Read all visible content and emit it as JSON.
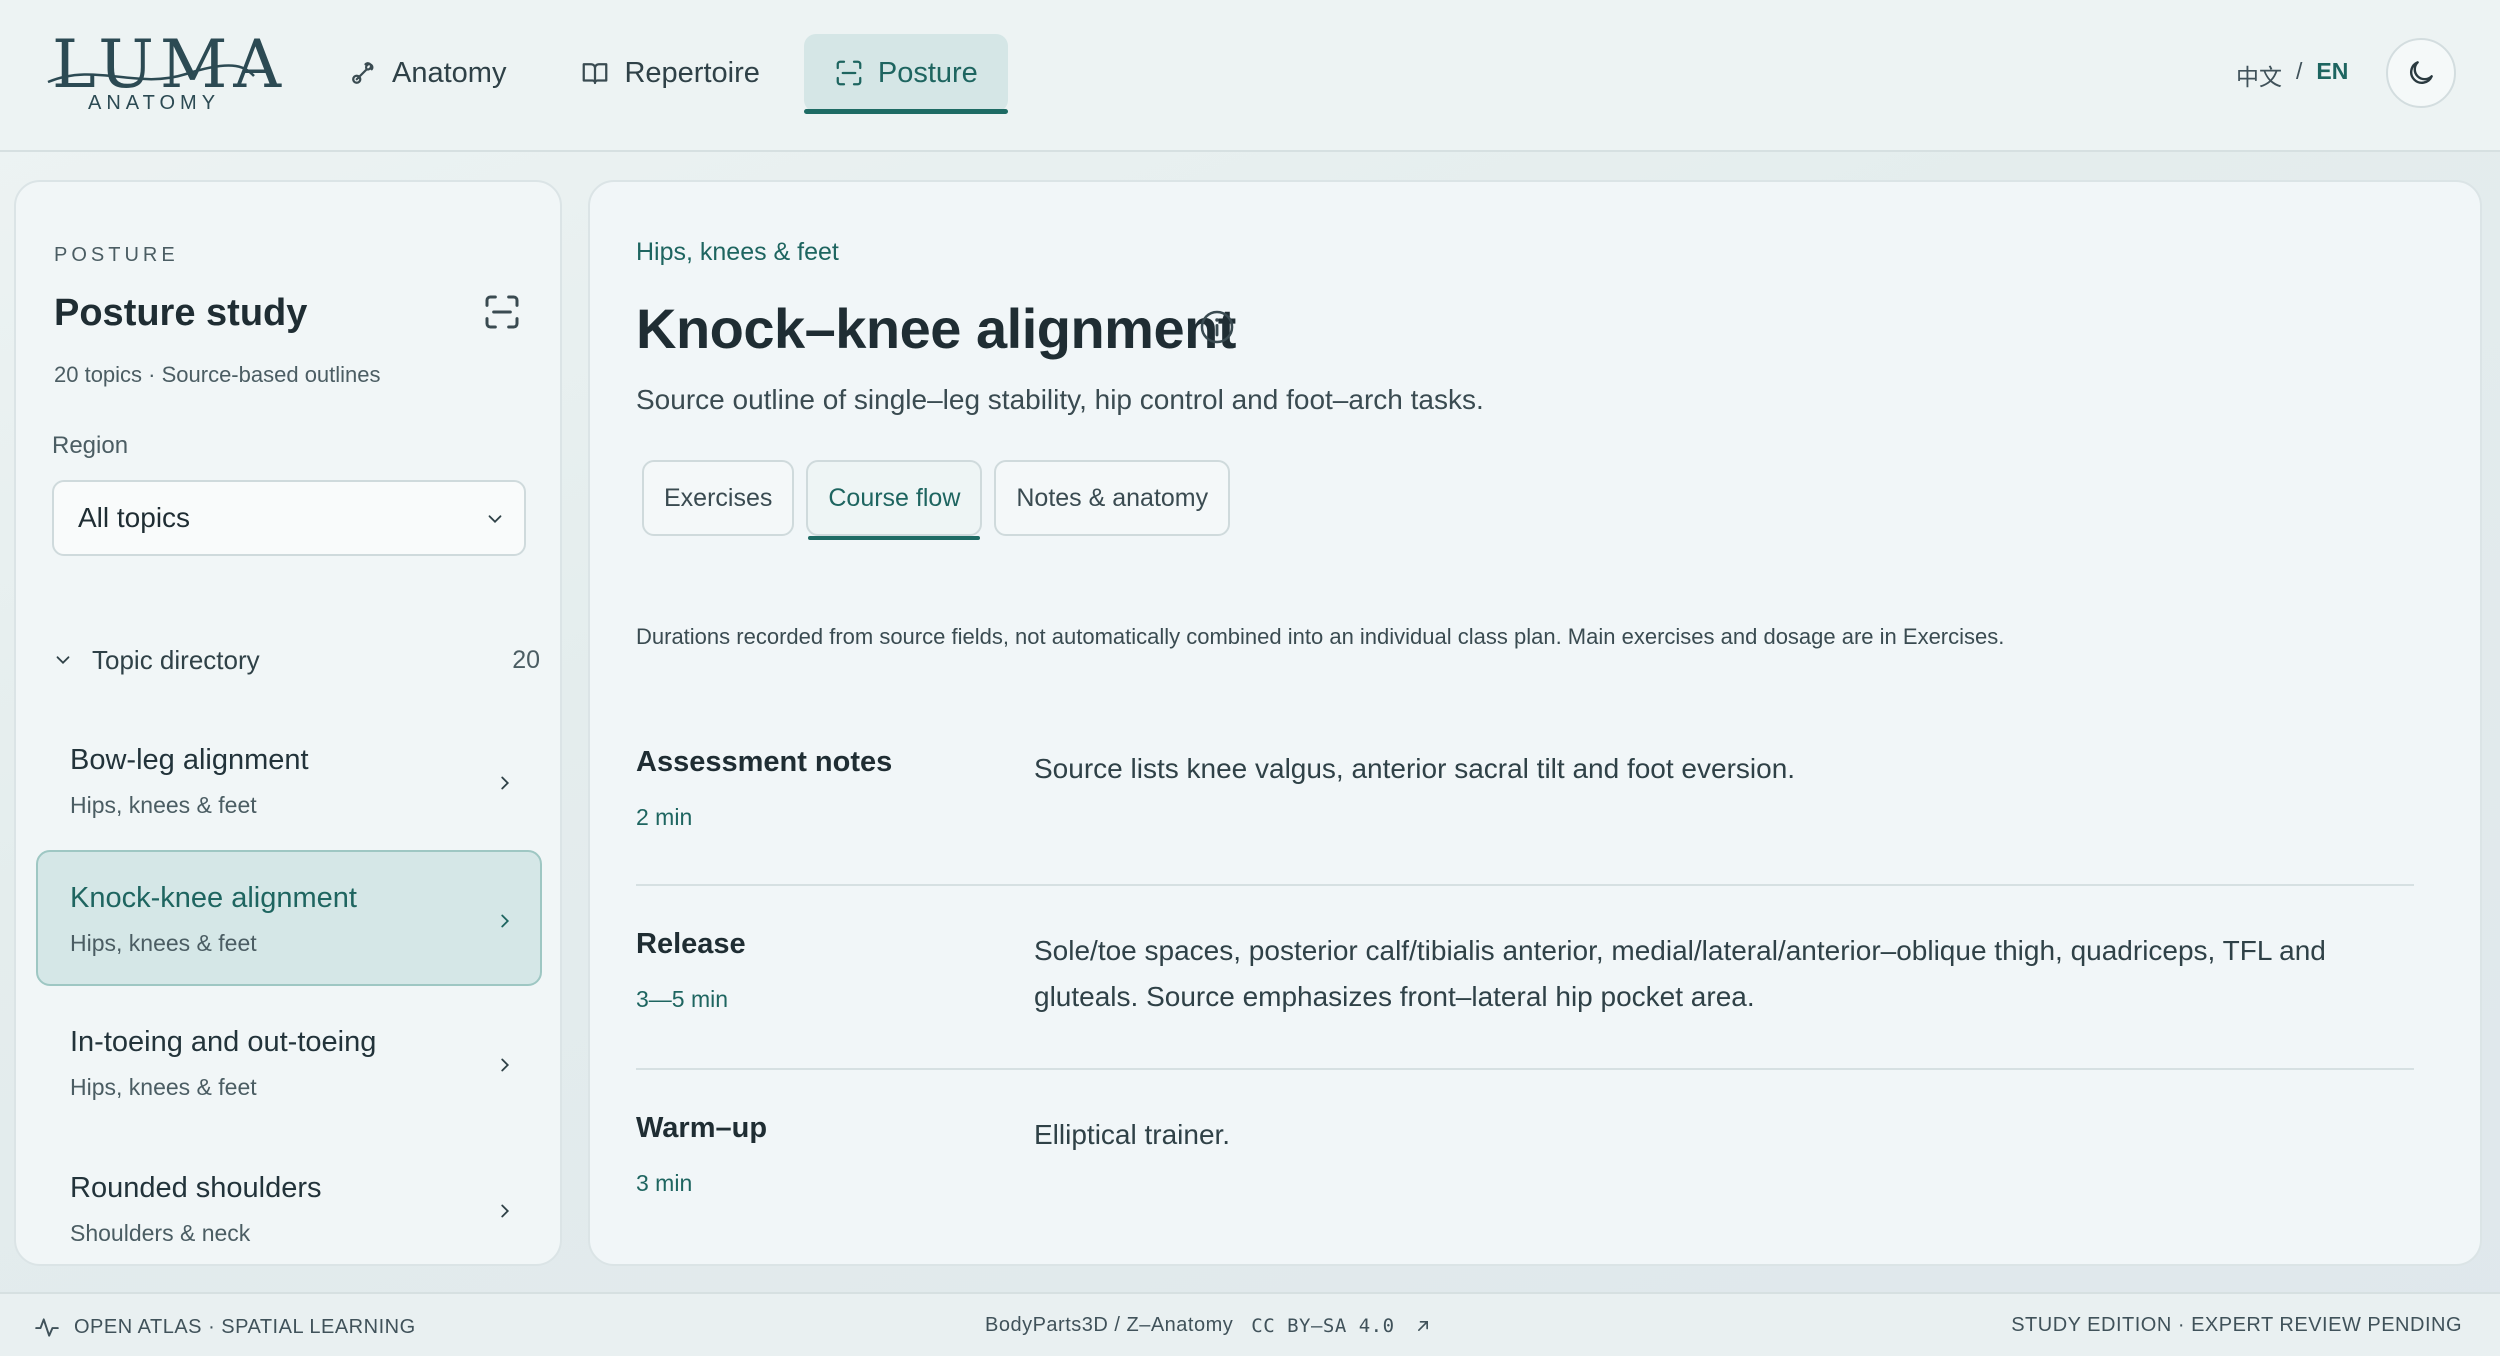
{
  "brand": {
    "name": "LUMA",
    "sub": "ANATOMY"
  },
  "nav": [
    {
      "label": "Anatomy",
      "icon": "bone-icon"
    },
    {
      "label": "Repertoire",
      "icon": "book-icon"
    },
    {
      "label": "Posture",
      "icon": "scan-icon",
      "active": true
    }
  ],
  "lang": {
    "zh": "中文",
    "sep": "/",
    "en": "EN"
  },
  "sidebar": {
    "kicker": "POSTURE",
    "title": "Posture study",
    "meta": "20 topics · Source-based outlines",
    "region_label": "Region",
    "region_value": "All topics",
    "directory_label": "Topic directory",
    "directory_count": "20",
    "topics": [
      {
        "name": "Bow-leg alignment",
        "sub": "Hips, knees & feet"
      },
      {
        "name": "Knock-knee alignment",
        "sub": "Hips, knees & feet",
        "active": true
      },
      {
        "name": "In-toeing and out-toeing",
        "sub": "Hips, knees & feet"
      },
      {
        "name": "Rounded shoulders",
        "sub": "Shoulders & neck"
      }
    ]
  },
  "main": {
    "crumb": "Hips, knees & feet",
    "title": "Knock–knee alignment",
    "subtitle": "Source outline of single–leg stability, hip control and foot–arch tasks.",
    "tabs": [
      {
        "label": "Exercises"
      },
      {
        "label": "Course flow",
        "active": true
      },
      {
        "label": "Notes & anatomy"
      }
    ],
    "note": "Durations recorded from source fields, not automatically combined into an individual class plan. Main exercises and dosage are in Exercises.",
    "flow": [
      {
        "name": "Assessment notes",
        "duration": "2 min",
        "desc": "Source lists knee valgus, anterior sacral tilt and foot eversion."
      },
      {
        "name": "Release",
        "duration": "3—5 min",
        "desc": "Sole/toe spaces, posterior calf/tibialis anterior, medial/lateral/anterior–oblique thigh, quadriceps, TFL and gluteals. Source emphasizes front–lateral hip pocket area."
      },
      {
        "name": "Warm–up",
        "duration": "3 min",
        "desc": "Elliptical trainer."
      }
    ]
  },
  "footer": {
    "left": "OPEN ATLAS · SPATIAL LEARNING",
    "source": "BodyParts3D / Z–Anatomy",
    "license": "CC BY–SA 4.0",
    "right": "STUDY EDITION · EXPERT REVIEW PENDING"
  },
  "colors": {
    "accent": "#1e6560",
    "active_bg": "#d5e7e7",
    "text": "#1f2d33"
  }
}
